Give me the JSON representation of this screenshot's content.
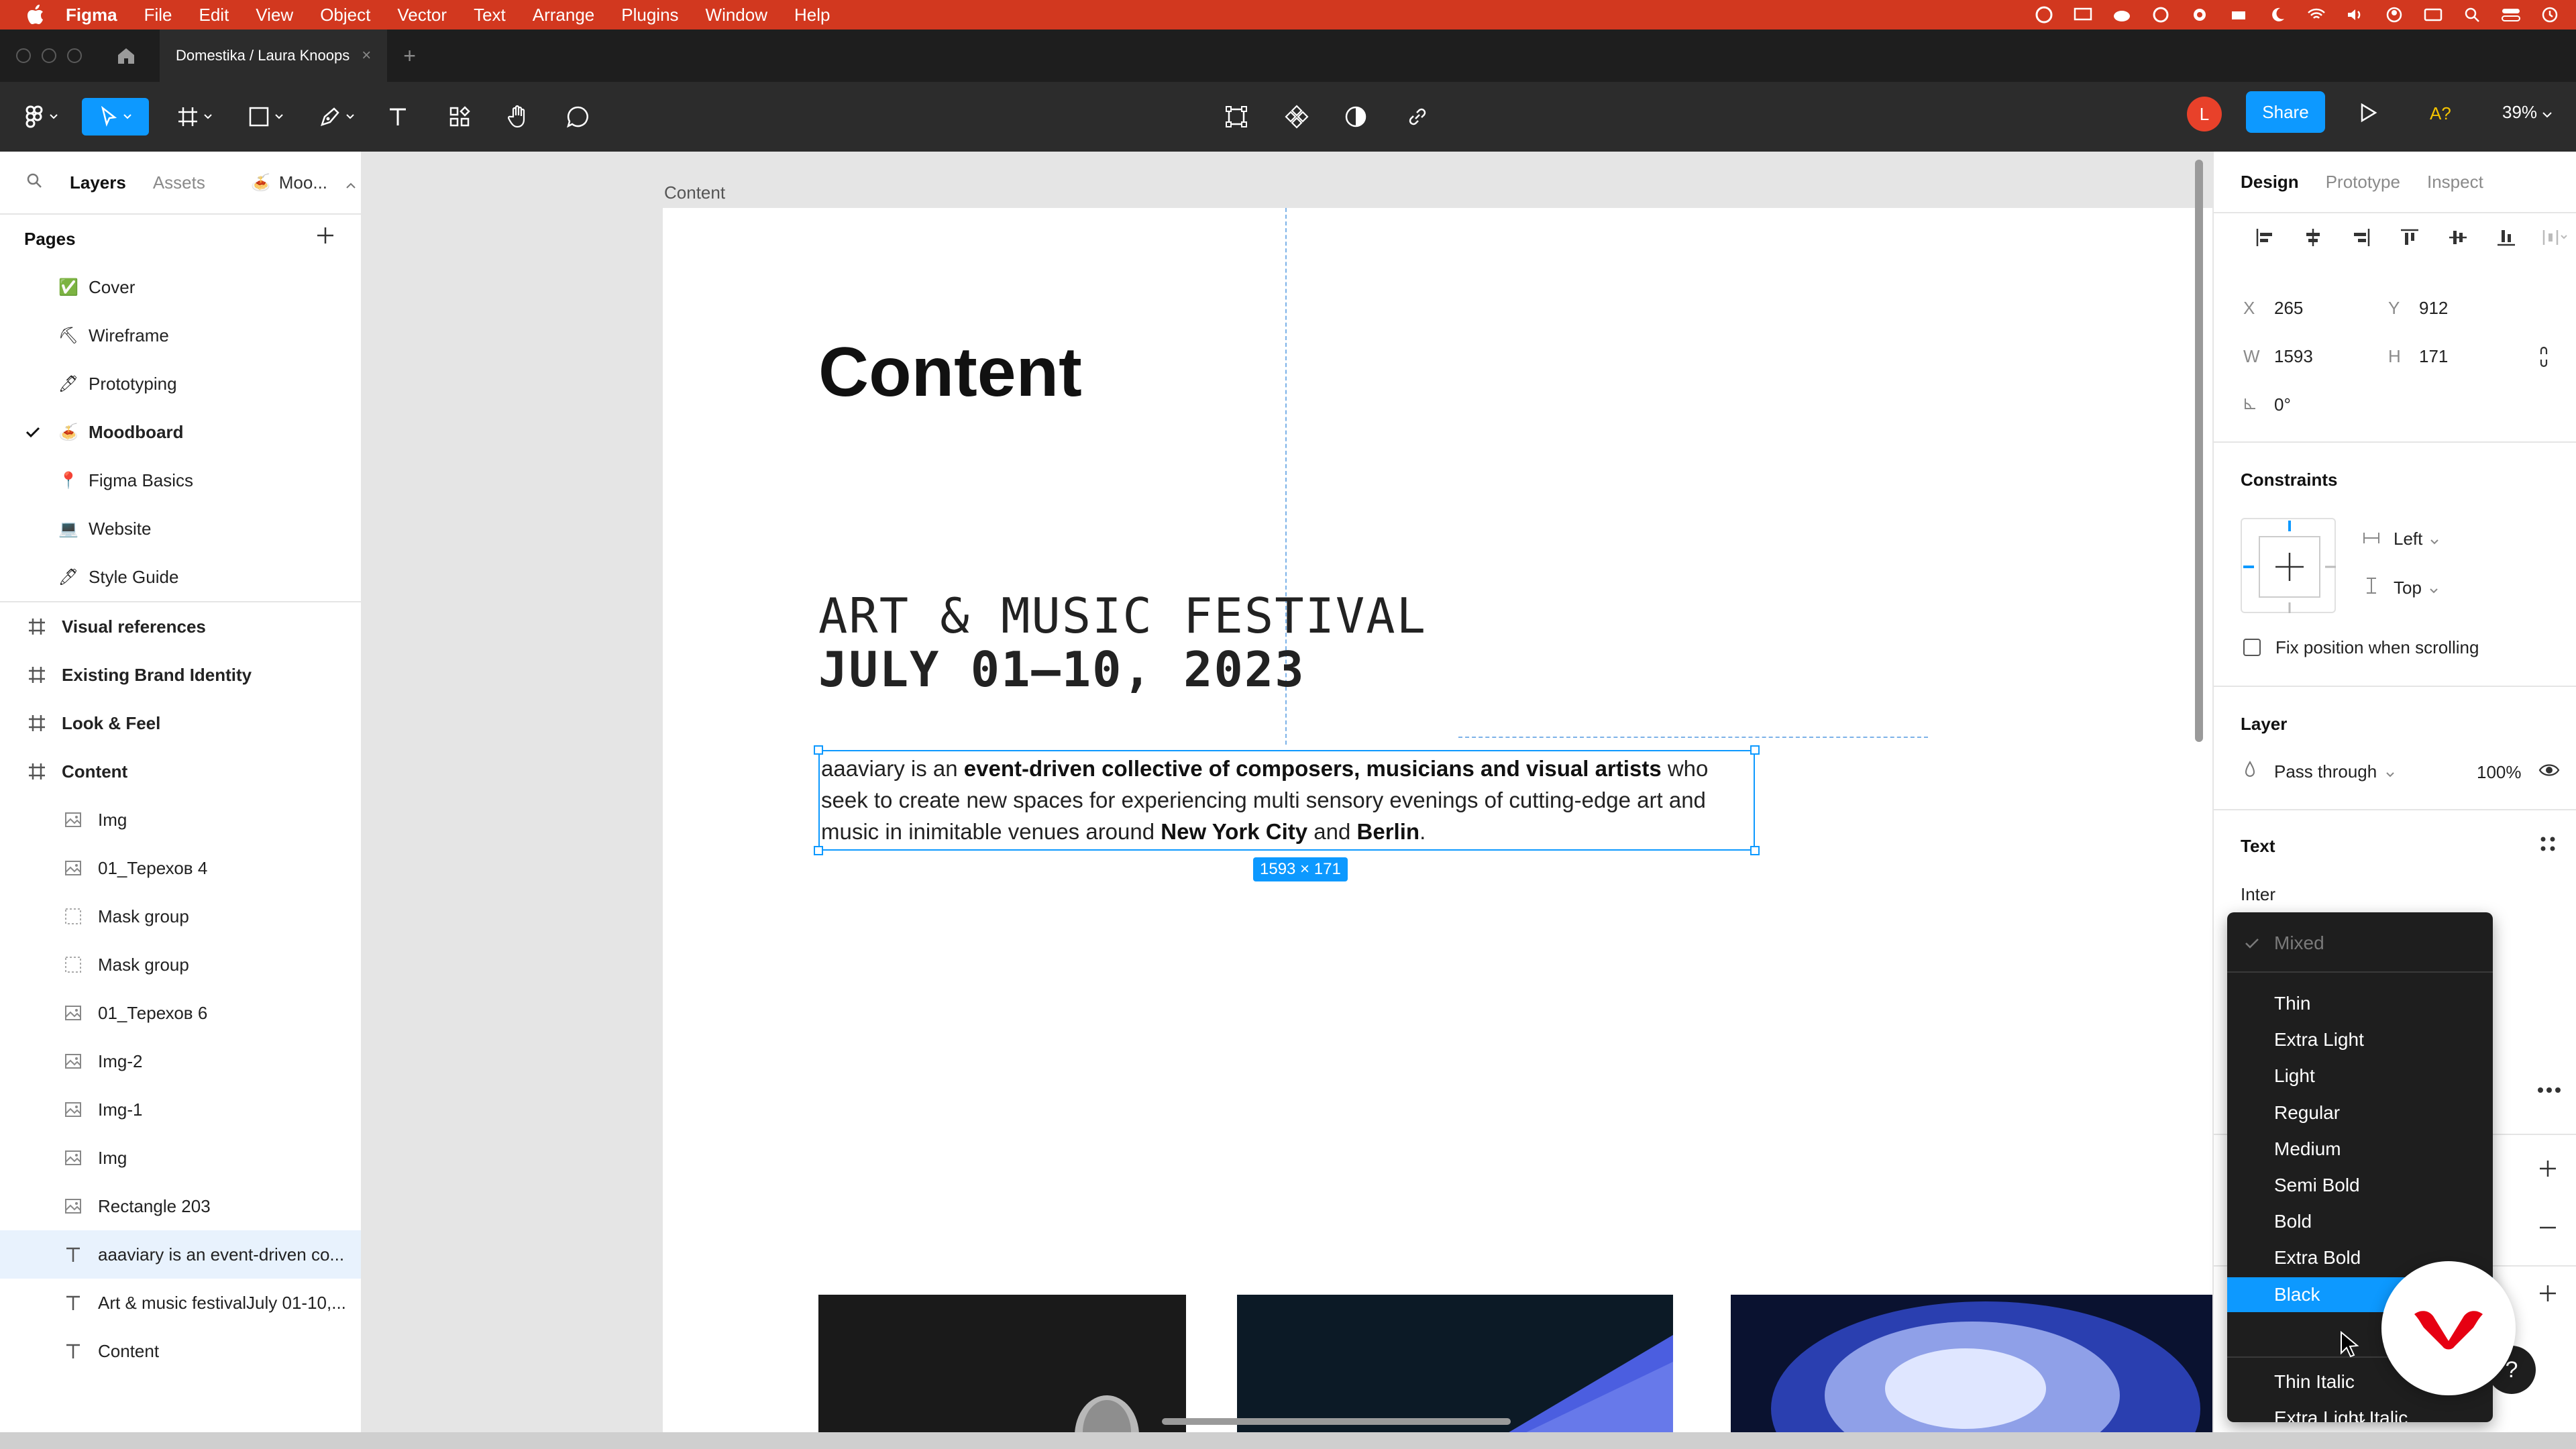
{
  "menubar": {
    "app": "Figma",
    "items": [
      "File",
      "Edit",
      "View",
      "Object",
      "Vector",
      "Text",
      "Arrange",
      "Plugins",
      "Window",
      "Help"
    ]
  },
  "tabbar": {
    "document_tab": "Domestika / Laura Knoops"
  },
  "toolbar": {
    "avatar_initial": "L",
    "share_label": "Share",
    "ai_label": "A?",
    "zoom": "39%"
  },
  "left_panel": {
    "tabs": [
      "Layers",
      "Assets"
    ],
    "current_page_pill": "Moo...",
    "pages_title": "Pages",
    "pages": [
      {
        "emoji": "✅",
        "label": "Cover",
        "current": false
      },
      {
        "emoji": "⛏",
        "label": "Wireframe",
        "current": false
      },
      {
        "emoji": "🖊",
        "label": "Prototyping",
        "current": false
      },
      {
        "emoji": "🍝",
        "label": "Moodboard",
        "current": true
      },
      {
        "emoji": "📍",
        "label": "Figma Basics",
        "current": false
      },
      {
        "emoji": "💻",
        "label": "Website",
        "current": false
      },
      {
        "emoji": "🖊",
        "label": "Style Guide",
        "current": false
      }
    ],
    "layers": [
      {
        "type": "frame",
        "label": "Visual references"
      },
      {
        "type": "frame",
        "label": "Existing Brand Identity"
      },
      {
        "type": "frame",
        "label": "Look & Feel"
      },
      {
        "type": "frame",
        "label": "Content"
      },
      {
        "type": "image",
        "label": "Img"
      },
      {
        "type": "image",
        "label": "01_Терехов 4"
      },
      {
        "type": "mask",
        "label": "Mask group"
      },
      {
        "type": "mask",
        "label": "Mask group"
      },
      {
        "type": "image",
        "label": "01_Терехов 6"
      },
      {
        "type": "image",
        "label": "Img-2"
      },
      {
        "type": "image",
        "label": "Img-1"
      },
      {
        "type": "image",
        "label": "Img"
      },
      {
        "type": "image",
        "label": "Rectangle 203"
      },
      {
        "type": "text",
        "label": "aaaviary is an event-driven co...",
        "selected": true
      },
      {
        "type": "text",
        "label": "Art & music festivalJuly 01-10,..."
      },
      {
        "type": "text",
        "label": "Content"
      }
    ]
  },
  "canvas": {
    "frame_label": "Content",
    "heading": "Content",
    "festival_line1": "ART & MUSIC FESTIVAL",
    "festival_line2": "JULY 01–10, 2023",
    "paragraph": {
      "p1": "aaaviary is an ",
      "b1": "event-driven collective of composers, musicians and visual artists",
      "p2": " who seek to create new spaces for experiencing multi sensory evenings of cutting-edge art and music in inimitable venues around ",
      "b2": "New York City",
      "p3": " and ",
      "b3": "Berlin",
      "p4": "."
    },
    "size_badge": "1593 × 171"
  },
  "right_panel": {
    "tabs": [
      "Design",
      "Prototype",
      "Inspect"
    ],
    "x_label": "X",
    "x": "265",
    "y_label": "Y",
    "y": "912",
    "w_label": "W",
    "w": "1593",
    "h_label": "H",
    "h": "171",
    "rotation": "0°",
    "constraints_title": "Constraints",
    "constraint_h": "Left",
    "constraint_v": "Top",
    "fix_position": "Fix position when scrolling",
    "layer_title": "Layer",
    "blend_mode": "Pass through",
    "opacity": "100%",
    "text_title": "Text",
    "font_family": "Inter"
  },
  "weight_dropdown": {
    "header": "Mixed",
    "options": [
      "Thin",
      "Extra Light",
      "Light",
      "Regular",
      "Medium",
      "Semi Bold",
      "Bold",
      "Extra Bold",
      "Black"
    ],
    "selected": "Black",
    "italic_options": [
      "Thin Italic",
      "Extra Light Italic"
    ]
  },
  "help": {
    "label": "?"
  },
  "colors": {
    "menubar": "#d2381f",
    "accent": "#0d99ff",
    "toolbar": "#2c2c2c",
    "dropdown": "#1e1e1e"
  }
}
